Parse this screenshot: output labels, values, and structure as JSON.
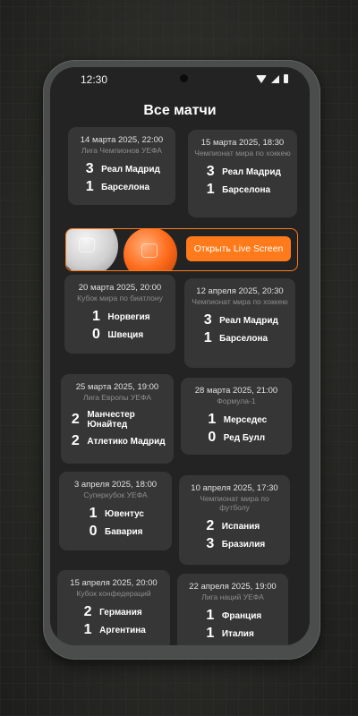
{
  "status_bar": {
    "time": "12:30"
  },
  "header": {
    "title": "Все матчи"
  },
  "banner": {
    "button_label": "Открыть Live Screen"
  },
  "matches": [
    {
      "date": "14 марта 2025, 22:00",
      "league": "Лига Чемпионов УЕФА",
      "team1": "Реал Мадрид",
      "score1": "3",
      "team2": "Барселона",
      "score2": "1"
    },
    {
      "date": "15 марта 2025, 18:30",
      "league": "Чемпионат мира по хоккею",
      "team1": "Реал Мадрид",
      "score1": "3",
      "team2": "Барселона",
      "score2": "1"
    },
    {
      "date": "20 марта 2025, 20:00",
      "league": "Кубок мира по биатлону",
      "team1": "Норвегия",
      "score1": "1",
      "team2": "Швеция",
      "score2": "0"
    },
    {
      "date": "12 апреля 2025, 20:30",
      "league": "Чемпионат мира по хоккею",
      "team1": "Реал Мадрид",
      "score1": "3",
      "team2": "Барселона",
      "score2": "1"
    },
    {
      "date": "25 марта 2025, 19:00",
      "league": "Лига Европы УЕФА",
      "team1": "Манчестер Юнайтед",
      "score1": "2",
      "team2": "Атлетико Мадрид",
      "score2": "2"
    },
    {
      "date": "28 марта 2025, 21:00",
      "league": "Формула-1",
      "team1": "Мерседес",
      "score1": "1",
      "team2": "Ред Булл",
      "score2": "0"
    },
    {
      "date": "3 апреля 2025, 18:00",
      "league": "Суперкубок УЕФА",
      "team1": "Ювентус",
      "score1": "1",
      "team2": "Бавария",
      "score2": "0"
    },
    {
      "date": "10 апреля 2025, 17:30",
      "league": "Чемпионат мира по футболу",
      "team1": "Испания",
      "score1": "2",
      "team2": "Бразилия",
      "score2": "3"
    },
    {
      "date": "15 апреля 2025, 20:00",
      "league": "Кубок конфедераций",
      "team1": "Германия",
      "score1": "2",
      "team2": "Аргентина",
      "score2": "1"
    },
    {
      "date": "22 апреля 2025, 19:00",
      "league": "Лига наций УЕФА",
      "team1": "Франция",
      "score1": "1",
      "team2": "Италия",
      "score2": "1"
    }
  ]
}
